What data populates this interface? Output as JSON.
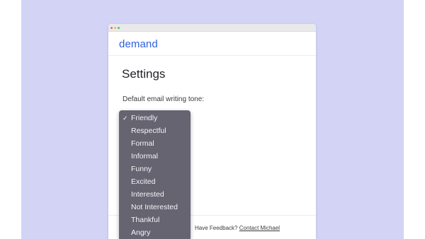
{
  "app": {
    "brand": "demand"
  },
  "settings": {
    "title": "Settings",
    "tone_label": "Default email writing tone:"
  },
  "tone_dropdown": {
    "selected": "Friendly",
    "check_glyph": "✓",
    "options": [
      "Friendly",
      "Respectful",
      "Formal",
      "Informal",
      "Funny",
      "Excited",
      "Interested",
      "Not Interested",
      "Thankful",
      "Angry"
    ]
  },
  "footer": {
    "feedback_prefix": "Have Feedback?",
    "contact_link": "Contact Michael"
  },
  "colors": {
    "backdrop": "#d3d3f6",
    "brand": "#2f5fe0",
    "dropdown_bg": "#666470",
    "traffic_red": "#f06a5f",
    "traffic_yellow": "#f5be3c",
    "traffic_green": "#56c257"
  }
}
